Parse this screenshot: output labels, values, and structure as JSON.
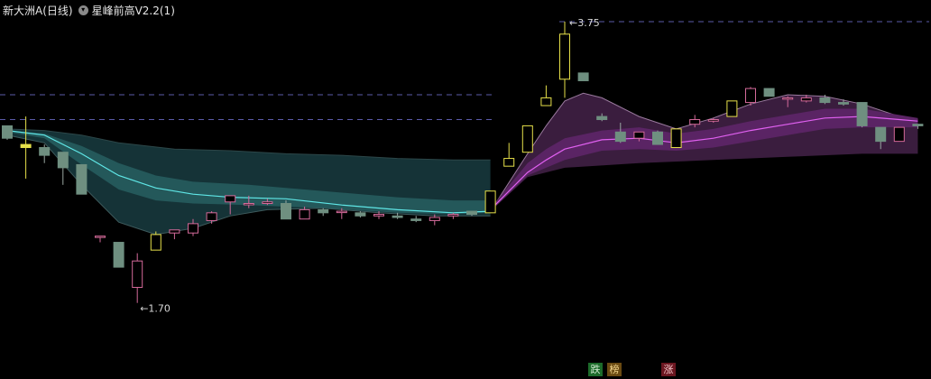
{
  "header": {
    "stock_title": "新大洲A(日线)",
    "indicator_name": "星峰前高V2.2(1)"
  },
  "badges": [
    {
      "name": "die-badge",
      "label": "跌",
      "bg": "#1c6b2a",
      "fg": "#cfe8cf"
    },
    {
      "name": "bang-badge",
      "label": "榜",
      "bg": "#6a4a12",
      "fg": "#f0d38a"
    },
    {
      "name": "zhang-badge",
      "label": "涨",
      "bg": "#6b1620",
      "fg": "#f2c4c8"
    }
  ],
  "colors": {
    "background": "#000000",
    "up_body": "#000000",
    "up_edge_normal": "#d46a9a",
    "up_edge_limit": "#e6e04a",
    "down_fill": "#6f8f80",
    "down_limit_fill": "#e6e04a",
    "band_teal_mid": "#24585a",
    "band_teal_outer": "#16363a",
    "band_teal_inner": "#2f6d6c",
    "line_cyan": "#5fe6e6",
    "band_purple_outer": "#3a1d3e",
    "band_purple_mid": "#5a2464",
    "band_purple_inner": "#7a2e86",
    "line_magenta": "#e060f0",
    "dashed_level": "#5a5aa8"
  },
  "chart_data": {
    "type": "candlestick",
    "price_range": [
      1.52,
      3.82
    ],
    "high_label": "3.75",
    "low_label": "1.70",
    "dashed_levels": [
      3.75,
      3.28,
      3.12
    ],
    "candles": [
      {
        "o": 3.08,
        "c": 3.0,
        "h": 3.08,
        "l": 2.99,
        "t": "down"
      },
      {
        "o": 2.96,
        "c": 2.94,
        "h": 3.14,
        "l": 2.74,
        "t": "downlimit"
      },
      {
        "o": 2.94,
        "c": 2.89,
        "h": 2.96,
        "l": 2.84,
        "t": "down"
      },
      {
        "o": 2.91,
        "c": 2.81,
        "h": 2.91,
        "l": 2.7,
        "t": "down"
      },
      {
        "o": 2.83,
        "c": 2.64,
        "h": 2.83,
        "l": 2.64,
        "t": "down"
      },
      {
        "o": 2.37,
        "c": 2.37,
        "h": 2.37,
        "l": 2.33,
        "t": "up"
      },
      {
        "o": 2.33,
        "c": 2.17,
        "h": 2.33,
        "l": 2.17,
        "t": "down"
      },
      {
        "o": 2.04,
        "c": 2.21,
        "h": 2.26,
        "l": 1.94,
        "t": "up"
      },
      {
        "o": 2.28,
        "c": 2.38,
        "h": 2.4,
        "l": 2.28,
        "t": "uplimit"
      },
      {
        "o": 2.39,
        "c": 2.41,
        "h": 2.41,
        "l": 2.35,
        "t": "up"
      },
      {
        "o": 2.39,
        "c": 2.45,
        "h": 2.48,
        "l": 2.37,
        "t": "up"
      },
      {
        "o": 2.47,
        "c": 2.52,
        "h": 2.53,
        "l": 2.45,
        "t": "up"
      },
      {
        "o": 2.59,
        "c": 2.63,
        "h": 2.63,
        "l": 2.51,
        "t": "up"
      },
      {
        "o": 2.58,
        "c": 2.58,
        "h": 2.63,
        "l": 2.55,
        "t": "up"
      },
      {
        "o": 2.58,
        "c": 2.59,
        "h": 2.61,
        "l": 2.57,
        "t": "up"
      },
      {
        "o": 2.58,
        "c": 2.48,
        "h": 2.6,
        "l": 2.48,
        "t": "down"
      },
      {
        "o": 2.48,
        "c": 2.54,
        "h": 2.56,
        "l": 2.48,
        "t": "up"
      },
      {
        "o": 2.52,
        "c": 2.54,
        "h": 2.55,
        "l": 2.5,
        "t": "down"
      },
      {
        "o": 2.53,
        "c": 2.53,
        "h": 2.55,
        "l": 2.48,
        "t": "up"
      },
      {
        "o": 2.52,
        "c": 2.5,
        "h": 2.53,
        "l": 2.49,
        "t": "down"
      },
      {
        "o": 2.51,
        "c": 2.5,
        "h": 2.53,
        "l": 2.48,
        "t": "up"
      },
      {
        "o": 2.5,
        "c": 2.49,
        "h": 2.52,
        "l": 2.48,
        "t": "down"
      },
      {
        "o": 2.48,
        "c": 2.47,
        "h": 2.5,
        "l": 2.46,
        "t": "down"
      },
      {
        "o": 2.47,
        "c": 2.49,
        "h": 2.51,
        "l": 2.44,
        "t": "up"
      },
      {
        "o": 2.5,
        "c": 2.51,
        "h": 2.52,
        "l": 2.48,
        "t": "up"
      },
      {
        "o": 2.53,
        "c": 2.51,
        "h": 2.53,
        "l": 2.5,
        "t": "down"
      },
      {
        "o": 2.52,
        "c": 2.66,
        "h": 2.66,
        "l": 2.52,
        "t": "uplimit"
      },
      {
        "o": 2.82,
        "c": 2.87,
        "h": 2.97,
        "l": 2.82,
        "t": "uplimit"
      },
      {
        "o": 2.91,
        "c": 3.08,
        "h": 3.08,
        "l": 2.91,
        "t": "uplimit"
      },
      {
        "o": 3.21,
        "c": 3.26,
        "h": 3.34,
        "l": 3.21,
        "t": "uplimit"
      },
      {
        "o": 3.38,
        "c": 3.67,
        "h": 3.75,
        "l": 3.26,
        "t": "uplimit"
      },
      {
        "o": 3.42,
        "c": 3.37,
        "h": 3.42,
        "l": 3.37,
        "t": "down"
      },
      {
        "o": 3.14,
        "c": 3.12,
        "h": 3.16,
        "l": 3.11,
        "t": "down"
      },
      {
        "o": 3.04,
        "c": 2.98,
        "h": 3.1,
        "l": 2.97,
        "t": "down"
      },
      {
        "o": 3.0,
        "c": 3.04,
        "h": 3.04,
        "l": 2.98,
        "t": "up"
      },
      {
        "o": 3.04,
        "c": 2.96,
        "h": 3.05,
        "l": 2.96,
        "t": "down"
      },
      {
        "o": 2.94,
        "c": 3.06,
        "h": 3.06,
        "l": 2.94,
        "t": "uplimit"
      },
      {
        "o": 3.09,
        "c": 3.12,
        "h": 3.15,
        "l": 3.07,
        "t": "up"
      },
      {
        "o": 3.11,
        "c": 3.12,
        "h": 3.13,
        "l": 3.1,
        "t": "up"
      },
      {
        "o": 3.14,
        "c": 3.24,
        "h": 3.24,
        "l": 3.14,
        "t": "uplimit"
      },
      {
        "o": 3.23,
        "c": 3.32,
        "h": 3.33,
        "l": 3.21,
        "t": "up"
      },
      {
        "o": 3.32,
        "c": 3.27,
        "h": 3.32,
        "l": 3.27,
        "t": "down"
      },
      {
        "o": 3.26,
        "c": 3.26,
        "h": 3.27,
        "l": 3.2,
        "t": "up"
      },
      {
        "o": 3.24,
        "c": 3.26,
        "h": 3.28,
        "l": 3.23,
        "t": "up"
      },
      {
        "o": 3.26,
        "c": 3.23,
        "h": 3.28,
        "l": 3.22,
        "t": "down"
      },
      {
        "o": 3.23,
        "c": 3.22,
        "h": 3.25,
        "l": 3.21,
        "t": "down"
      },
      {
        "o": 3.23,
        "c": 3.08,
        "h": 3.23,
        "l": 3.07,
        "t": "down"
      },
      {
        "o": 3.07,
        "c": 2.98,
        "h": 3.07,
        "l": 2.93,
        "t": "down"
      },
      {
        "o": 2.98,
        "c": 3.07,
        "h": 3.07,
        "l": 2.98,
        "t": "up"
      },
      {
        "o": 3.09,
        "c": 3.08,
        "h": 3.09,
        "l": 3.06,
        "t": "down"
      }
    ],
    "bands": {
      "teal": {
        "upper": [
          [
            0,
            3.06
          ],
          [
            2,
            3.05
          ],
          [
            4,
            3.02
          ],
          [
            6,
            2.97
          ],
          [
            9,
            2.93
          ],
          [
            12,
            2.92
          ],
          [
            15,
            2.9
          ],
          [
            18,
            2.89
          ],
          [
            21,
            2.87
          ],
          [
            24,
            2.86
          ],
          [
            26,
            2.86
          ]
        ],
        "lower": [
          [
            0,
            3.02
          ],
          [
            2,
            2.97
          ],
          [
            4,
            2.7
          ],
          [
            6,
            2.46
          ],
          [
            8,
            2.38
          ],
          [
            10,
            2.42
          ],
          [
            12,
            2.5
          ],
          [
            14,
            2.54
          ],
          [
            17,
            2.55
          ],
          [
            20,
            2.52
          ],
          [
            23,
            2.5
          ],
          [
            26,
            2.5
          ]
        ],
        "mid": [
          [
            0,
            3.05
          ],
          [
            2,
            3.02
          ],
          [
            4,
            2.9
          ],
          [
            6,
            2.76
          ],
          [
            8,
            2.68
          ],
          [
            10,
            2.64
          ],
          [
            12,
            2.62
          ],
          [
            15,
            2.61
          ],
          [
            18,
            2.57
          ],
          [
            21,
            2.54
          ],
          [
            24,
            2.52
          ],
          [
            26,
            2.53
          ]
        ],
        "inner_upper": [
          [
            0,
            3.05
          ],
          [
            2,
            3.03
          ],
          [
            4,
            2.95
          ],
          [
            6,
            2.84
          ],
          [
            8,
            2.76
          ],
          [
            10,
            2.72
          ],
          [
            13,
            2.7
          ],
          [
            17,
            2.66
          ],
          [
            21,
            2.62
          ],
          [
            24,
            2.6
          ],
          [
            26,
            2.6
          ]
        ],
        "inner_lower": [
          [
            0,
            3.04
          ],
          [
            2,
            3.0
          ],
          [
            4,
            2.83
          ],
          [
            6,
            2.67
          ],
          [
            8,
            2.6
          ],
          [
            10,
            2.58
          ],
          [
            13,
            2.57
          ],
          [
            17,
            2.55
          ],
          [
            21,
            2.52
          ],
          [
            24,
            2.51
          ],
          [
            26,
            2.52
          ]
        ]
      },
      "purple": {
        "upper": [
          [
            26,
            2.53
          ],
          [
            28,
            2.9
          ],
          [
            29,
            3.08
          ],
          [
            30,
            3.24
          ],
          [
            31,
            3.29
          ],
          [
            32,
            3.26
          ],
          [
            34,
            3.14
          ],
          [
            36,
            3.06
          ],
          [
            38,
            3.13
          ],
          [
            40,
            3.22
          ],
          [
            42,
            3.28
          ],
          [
            44,
            3.27
          ],
          [
            46,
            3.22
          ],
          [
            48,
            3.14
          ],
          [
            49,
            3.12
          ]
        ],
        "lower": [
          [
            26,
            2.53
          ],
          [
            28,
            2.75
          ],
          [
            30,
            2.81
          ],
          [
            34,
            2.84
          ],
          [
            38,
            2.86
          ],
          [
            42,
            2.88
          ],
          [
            46,
            2.9
          ],
          [
            49,
            2.9
          ]
        ],
        "mid": [
          [
            26,
            2.54
          ],
          [
            28,
            2.78
          ],
          [
            29,
            2.86
          ],
          [
            30,
            2.93
          ],
          [
            32,
            2.99
          ],
          [
            34,
            3.0
          ],
          [
            36,
            2.97
          ],
          [
            38,
            3.0
          ],
          [
            40,
            3.05
          ],
          [
            42,
            3.09
          ],
          [
            44,
            3.13
          ],
          [
            46,
            3.14
          ],
          [
            48,
            3.12
          ],
          [
            49,
            3.11
          ]
        ],
        "inner_upper": [
          [
            26,
            2.55
          ],
          [
            28,
            2.84
          ],
          [
            29,
            2.93
          ],
          [
            30,
            3.0
          ],
          [
            32,
            3.05
          ],
          [
            34,
            3.07
          ],
          [
            36,
            3.03
          ],
          [
            38,
            3.06
          ],
          [
            40,
            3.11
          ],
          [
            42,
            3.15
          ],
          [
            44,
            3.19
          ],
          [
            46,
            3.19
          ],
          [
            48,
            3.15
          ],
          [
            49,
            3.13
          ]
        ],
        "inner_lower": [
          [
            26,
            2.53
          ],
          [
            28,
            2.76
          ],
          [
            30,
            2.86
          ],
          [
            32,
            2.92
          ],
          [
            34,
            2.93
          ],
          [
            36,
            2.92
          ],
          [
            38,
            2.94
          ],
          [
            40,
            2.98
          ],
          [
            42,
            3.02
          ],
          [
            44,
            3.06
          ],
          [
            46,
            3.07
          ],
          [
            48,
            3.07
          ],
          [
            49,
            3.07
          ]
        ]
      }
    }
  }
}
